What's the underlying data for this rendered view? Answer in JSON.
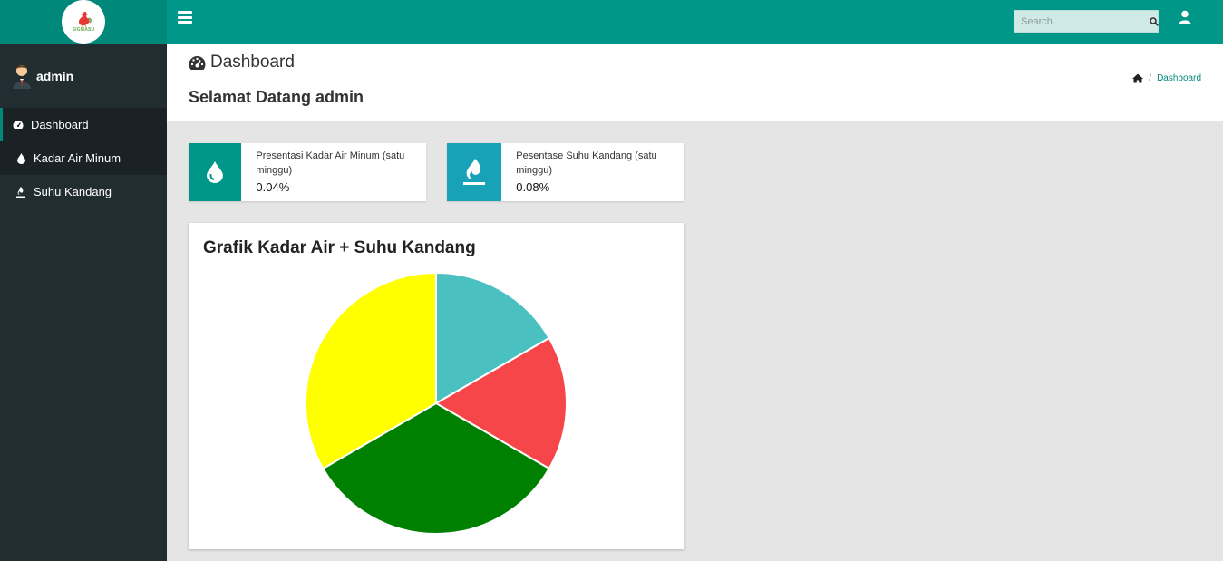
{
  "sidebar": {
    "logo_text": "SIGMASU",
    "user_name": "admin",
    "items": [
      {
        "label": "Dashboard",
        "icon": "tachometer-icon",
        "active": true
      },
      {
        "label": "Kadar Air Minum",
        "icon": "tint-icon",
        "active": false
      },
      {
        "label": "Suhu Kandang",
        "icon": "fire-icon",
        "active": false
      }
    ]
  },
  "topbar": {
    "search_placeholder": "Search"
  },
  "header": {
    "page_title": "Dashboard",
    "welcome": "Selamat Datang admin",
    "breadcrumb": "Dashboard"
  },
  "info_boxes": [
    {
      "label": "Presentasi Kadar Air Minum (satu minggu)",
      "value": "0.04%",
      "color": "#009688",
      "icon": "tint-icon"
    },
    {
      "label": "Pesentase Suhu Kandang (satu minggu)",
      "value": "0.08%",
      "color": "#17a2b8",
      "icon": "fire-icon"
    }
  ],
  "colors": {
    "primary": "#009688",
    "sidebar_bg": "#222d32",
    "info": "#17a2b8"
  },
  "card": {
    "title": "Grafik Kadar Air + Suhu Kandang"
  },
  "chart_data": {
    "type": "pie",
    "title": "Grafik Kadar Air + Suhu Kandang",
    "legend": "none",
    "series": [
      {
        "values": [
          1,
          1,
          2,
          2
        ],
        "colors": [
          "#4bc0c0",
          "#f7464a",
          "#008000",
          "#ffff00"
        ]
      }
    ]
  }
}
